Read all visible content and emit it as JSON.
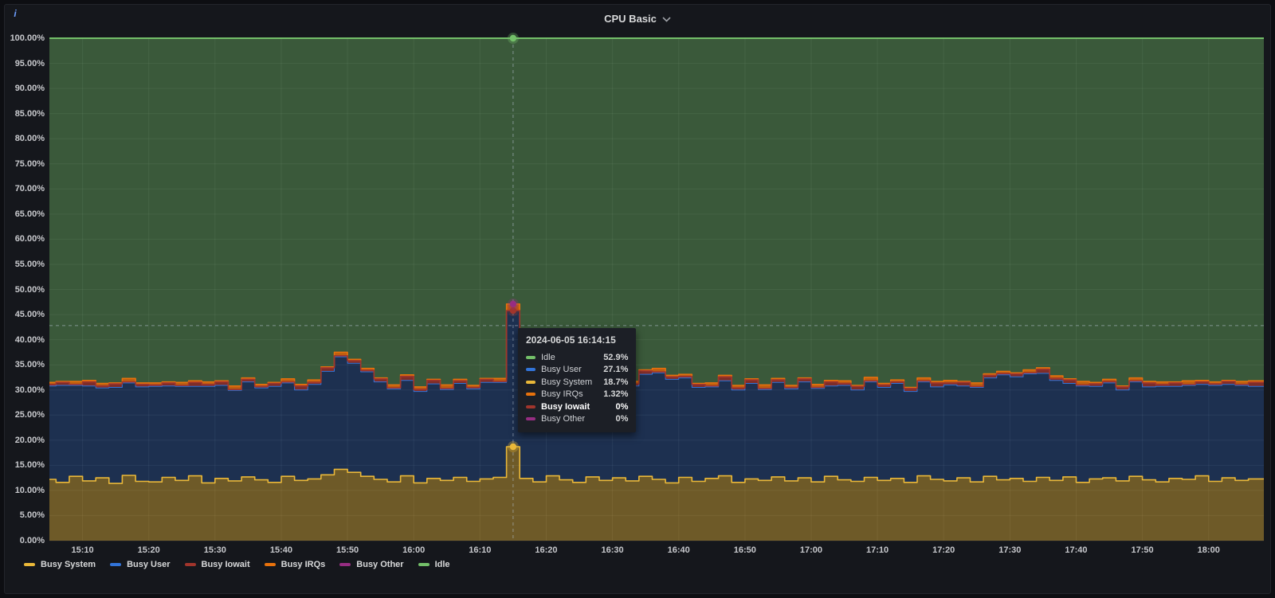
{
  "panel": {
    "title": "CPU Basic",
    "info_icon": "i"
  },
  "colors": {
    "busy_system": "#EAB839",
    "busy_user": "#3274D9",
    "busy_iowait": "#A1352C",
    "busy_irqs": "#E8720C",
    "busy_other": "#962D82",
    "idle": "#73BF69",
    "panel_bg": "#15171c",
    "grid": "rgba(255,255,255,0.07)",
    "tick_text": "#c8c9cd",
    "crosshair": "rgba(185,198,215,0.55)"
  },
  "tooltip": {
    "timestamp": "2024-06-05 16:14:15",
    "rows": [
      {
        "series": "idle",
        "label": "Idle",
        "value": "52.9%",
        "hovered": false
      },
      {
        "series": "busy_user",
        "label": "Busy User",
        "value": "27.1%",
        "hovered": false
      },
      {
        "series": "busy_system",
        "label": "Busy System",
        "value": "18.7%",
        "hovered": false
      },
      {
        "series": "busy_irqs",
        "label": "Busy IRQs",
        "value": "1.32%",
        "hovered": false
      },
      {
        "series": "busy_iowait",
        "label": "Busy Iowait",
        "value": "0%",
        "hovered": true
      },
      {
        "series": "busy_other",
        "label": "Busy Other",
        "value": "0%",
        "hovered": false
      }
    ]
  },
  "legend": {
    "items": [
      {
        "series": "busy_system",
        "label": "Busy System"
      },
      {
        "series": "busy_user",
        "label": "Busy User"
      },
      {
        "series": "busy_iowait",
        "label": "Busy Iowait"
      },
      {
        "series": "busy_irqs",
        "label": "Busy IRQs"
      },
      {
        "series": "busy_other",
        "label": "Busy Other"
      },
      {
        "series": "idle",
        "label": "Idle"
      }
    ]
  },
  "chart_data": {
    "type": "area",
    "stacked": true,
    "title": "CPU Basic",
    "xlabel": "",
    "ylabel": "",
    "y_unit": "percent",
    "ylim": [
      0,
      100
    ],
    "grid": true,
    "legend_position": "bottom-left",
    "x_start_time": "15:05",
    "x_total_minutes": 183.33,
    "sample_step_minutes": 2,
    "y_axis": {
      "tick_values": [
        0,
        5,
        10,
        15,
        20,
        25,
        30,
        35,
        40,
        45,
        50,
        55,
        60,
        65,
        70,
        75,
        80,
        85,
        90,
        95,
        100
      ],
      "tick_labels": [
        "0.00%",
        "5.00%",
        "10.00%",
        "15.00%",
        "20.00%",
        "25.00%",
        "30.00%",
        "35.00%",
        "40.00%",
        "45.00%",
        "50.00%",
        "55.00%",
        "60.00%",
        "65.00%",
        "70.00%",
        "75.00%",
        "80.00%",
        "85.00%",
        "90.00%",
        "95.00%",
        "100.00%"
      ]
    },
    "x_axis": {
      "tick_minutes": [
        5,
        15,
        25,
        35,
        45,
        55,
        65,
        75,
        85,
        95,
        105,
        115,
        125,
        135,
        145,
        155,
        165,
        175
      ],
      "tick_labels": [
        "15:10",
        "15:20",
        "15:30",
        "15:40",
        "15:50",
        "16:00",
        "16:10",
        "16:20",
        "16:30",
        "16:40",
        "16:50",
        "17:00",
        "17:10",
        "17:20",
        "17:30",
        "17:40",
        "17:50",
        "18:00"
      ]
    },
    "series": [
      {
        "name": "Busy System",
        "key": "busy_system",
        "values": [
          12.2,
          11.6,
          12.8,
          11.9,
          12.5,
          11.4,
          13.0,
          11.8,
          11.7,
          12.6,
          12.0,
          12.9,
          11.5,
          12.4,
          11.9,
          12.7,
          12.1,
          11.6,
          12.8,
          12.0,
          12.3,
          13.1,
          14.2,
          13.6,
          12.8,
          12.2,
          11.7,
          12.9,
          11.5,
          12.4,
          12.0,
          12.6,
          11.8,
          12.3,
          12.6,
          18.7,
          12.4,
          11.7,
          12.9,
          12.1,
          11.6,
          12.7,
          12.0,
          12.5,
          11.9,
          12.8,
          12.2,
          11.5,
          12.6,
          11.8,
          12.4,
          12.9,
          11.6,
          12.3,
          12.0,
          12.7,
          11.9,
          12.5,
          11.7,
          12.8,
          12.1,
          11.8,
          12.6,
          12.0,
          12.4,
          11.6,
          12.9,
          12.2,
          11.9,
          12.5,
          11.7,
          12.8,
          12.1,
          12.4,
          11.8,
          12.6,
          12.0,
          12.7,
          11.6,
          12.3,
          12.5,
          11.9,
          12.8,
          12.1,
          11.7,
          12.4,
          12.2,
          12.9,
          11.8,
          12.5,
          12.0,
          12.3
        ]
      },
      {
        "name": "Busy User",
        "key": "busy_user",
        "values": [
          18.6,
          19.3,
          18.1,
          18.9,
          17.9,
          19.1,
          18.4,
          18.8,
          19.0,
          18.2,
          18.7,
          17.8,
          19.2,
          18.5,
          18.0,
          18.9,
          18.3,
          19.1,
          18.6,
          18.0,
          18.8,
          20.6,
          22.4,
          21.7,
          20.8,
          19.4,
          18.5,
          19.0,
          18.2,
          18.8,
          18.1,
          18.7,
          18.4,
          19.2,
          18.9,
          27.1,
          18.6,
          18.0,
          19.1,
          18.3,
          18.8,
          18.2,
          19.0,
          18.5,
          18.9,
          20.3,
          21.2,
          20.6,
          19.8,
          18.7,
          18.2,
          18.9,
          18.4,
          19.0,
          18.1,
          18.8,
          18.3,
          19.1,
          18.6,
          18.0,
          18.8,
          18.2,
          19.0,
          18.5,
          18.9,
          18.1,
          18.7,
          18.4,
          19.1,
          18.3,
          18.8,
          19.6,
          20.9,
          20.2,
          21.4,
          20.7,
          19.9,
          18.6,
          19.2,
          18.4,
          18.9,
          18.1,
          18.8,
          18.5,
          19.0,
          18.3,
          18.7,
          18.2,
          19.1,
          18.6,
          18.9,
          18.4
        ]
      },
      {
        "name": "Busy Iowait",
        "key": "busy_iowait",
        "values": [
          0.3,
          0.6,
          0.2,
          0.8,
          0.4,
          0.7,
          0.2,
          0.5,
          0.3,
          0.6,
          0.2,
          0.8,
          0.4,
          0.7,
          0.2,
          0.5,
          0.3,
          0.6,
          0.2,
          0.8,
          0.4,
          0.7,
          0.2,
          0.5,
          0.3,
          0.6,
          0.2,
          0.8,
          0.4,
          0.7,
          0.2,
          0.5,
          0.3,
          0.6,
          0.2,
          0,
          0.4,
          0.7,
          0.2,
          0.5,
          0.3,
          0.6,
          0.2,
          0.8,
          0.4,
          0.7,
          0.2,
          0.5,
          0.3,
          0.6,
          0.2,
          0.8,
          0.4,
          0.7,
          0.2,
          0.5,
          0.3,
          0.6,
          0.2,
          0.8,
          0.4,
          0.7,
          0.2,
          0.5,
          0.3,
          0.6,
          0.2,
          0.8,
          0.4,
          0.7,
          0.2,
          0.5,
          0.3,
          0.6,
          0.2,
          0.8,
          0.4,
          0.7,
          0.2,
          0.5,
          0.3,
          0.6,
          0.2,
          0.8,
          0.4,
          0.7,
          0.2,
          0.5,
          0.3,
          0.6,
          0.2,
          0.8
        ]
      },
      {
        "name": "Busy IRQs",
        "key": "busy_irqs",
        "values": [
          0.4,
          0.2,
          0.6,
          0.3,
          0.5,
          0.2,
          0.7,
          0.3,
          0.4,
          0.2,
          0.6,
          0.3,
          0.5,
          0.2,
          0.7,
          0.3,
          0.4,
          0.2,
          0.6,
          0.3,
          0.5,
          0.2,
          0.7,
          0.3,
          0.4,
          0.2,
          0.6,
          0.3,
          0.5,
          0.2,
          0.7,
          0.3,
          0.4,
          0.2,
          0.6,
          1.32,
          0.5,
          0.2,
          0.7,
          0.3,
          0.4,
          0.2,
          0.6,
          0.3,
          0.5,
          0.2,
          0.7,
          0.3,
          0.4,
          0.2,
          0.6,
          0.3,
          0.5,
          0.2,
          0.7,
          0.3,
          0.4,
          0.2,
          0.6,
          0.3,
          0.5,
          0.2,
          0.7,
          0.3,
          0.4,
          0.2,
          0.6,
          0.3,
          0.5,
          0.2,
          0.7,
          0.3,
          0.4,
          0.2,
          0.6,
          0.3,
          0.5,
          0.2,
          0.7,
          0.3,
          0.4,
          0.2,
          0.6,
          0.3,
          0.5,
          0.2,
          0.7,
          0.3,
          0.4,
          0.2,
          0.6,
          0.3
        ]
      },
      {
        "name": "Busy Other",
        "key": "busy_other",
        "values": [
          0,
          0,
          0,
          0,
          0,
          0,
          0,
          0,
          0,
          0,
          0,
          0,
          0,
          0,
          0,
          0,
          0,
          0,
          0,
          0,
          0,
          0,
          0,
          0,
          0,
          0,
          0,
          0,
          0,
          0,
          0,
          0,
          0,
          0,
          0,
          0,
          0,
          0,
          0,
          0,
          0,
          0,
          0,
          0,
          0,
          0,
          0,
          0,
          0,
          0,
          0,
          0,
          0,
          0,
          0,
          0,
          0,
          0,
          0,
          0,
          0,
          0,
          0,
          0,
          0,
          0,
          0,
          0,
          0,
          0,
          0,
          0,
          0,
          0,
          0,
          0,
          0,
          0,
          0,
          0,
          0,
          0,
          0,
          0,
          0,
          0,
          0,
          0,
          0,
          0,
          0,
          0
        ]
      },
      {
        "name": "Idle",
        "key": "idle",
        "values_derived": "100 minus sum of all busy series"
      }
    ],
    "crosshair": {
      "time_min": 70,
      "cursor_value_pct": 42.8
    },
    "hover_markers": [
      {
        "series": "idle",
        "value": 100
      },
      {
        "series": "busy_iowait",
        "value": 45.8
      },
      {
        "series": "busy_other",
        "value": 47.1
      },
      {
        "series": "busy_system",
        "value": 18.7
      }
    ]
  }
}
